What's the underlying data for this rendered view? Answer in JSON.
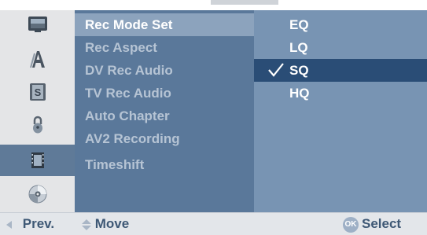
{
  "menu": {
    "items": [
      {
        "label": "Rec Mode Set",
        "active": true
      },
      {
        "label": "Rec Aspect",
        "active": false
      },
      {
        "label": "DV Rec Audio",
        "active": false
      },
      {
        "label": "TV Rec Audio",
        "active": false
      },
      {
        "label": "Auto Chapter",
        "active": false
      },
      {
        "label": "AV2 Recording",
        "active": false
      },
      {
        "label": "Timeshift",
        "active": false
      }
    ]
  },
  "options": {
    "items": [
      {
        "label": "EQ",
        "selected": false
      },
      {
        "label": "LQ",
        "selected": false
      },
      {
        "label": "SQ",
        "selected": true
      },
      {
        "label": "HQ",
        "selected": false
      }
    ]
  },
  "sidebar": {
    "icons": [
      {
        "name": "tv-display-icon"
      },
      {
        "name": "language-icon"
      },
      {
        "name": "audio-icon"
      },
      {
        "name": "lock-icon"
      },
      {
        "name": "recording-film-icon",
        "selected": true
      },
      {
        "name": "disc-icon"
      }
    ]
  },
  "help": {
    "prev_label": "Prev.",
    "move_label": "Move",
    "ok_badge": "OK",
    "select_label": "Select"
  },
  "colors": {
    "menu_bg": "#5a789a",
    "menu_active": "#8ca3bd",
    "option_bg": "#7894b3",
    "option_selected": "#2a4d76",
    "text_inactive": "#b6c4d4",
    "text_active": "#ffffff"
  }
}
